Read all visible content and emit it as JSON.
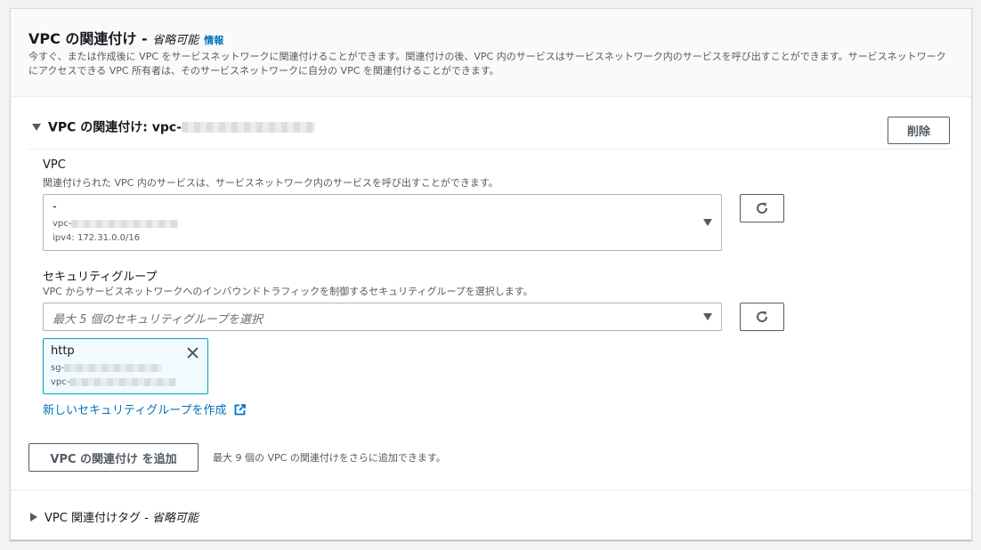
{
  "header": {
    "title": "VPC の関連付け - ",
    "optional": "省略可能",
    "info_link": "情報",
    "description": "今すぐ、または作成後に VPC をサービスネットワークに関連付けることができます。関連付けの後、VPC 内のサービスはサービスネットワーク内のサービスを呼び出すことができます。サービスネットワークにアクセスできる VPC 所有者は、そのサービスネットワークに自分の VPC を関連付けることができます。"
  },
  "association": {
    "title": "VPC の関連付け: vpc-",
    "remove_button": "削除",
    "vpc_field": {
      "label": "VPC",
      "hint": "関連付けられた VPC 内のサービスは、サービスネットワーク内のサービスを呼び出すことができます。",
      "selected_name": "-",
      "selected_id_prefix": "vpc-",
      "selected_cidr": "ipv4: 172.31.0.0/16"
    },
    "security_groups": {
      "label": "セキュリティグループ",
      "hint": "VPC からサービスネットワークへのインバウンドトラフィックを制御するセキュリティグループを選択します。",
      "placeholder": "最大 5 個のセキュリティグループを選択",
      "token": {
        "name": "http",
        "sg_prefix": "sg-",
        "vpc_prefix": "vpc-"
      },
      "create_link": "新しいセキュリティグループを作成"
    }
  },
  "add_button": "VPC の関連付け を追加",
  "add_hint": "最大 9 個の VPC の関連付けをさらに追加できます。",
  "tags_section": {
    "title": "VPC 関連付けタグ - ",
    "optional": "省略可能"
  },
  "icons": {
    "refresh": "refresh-icon",
    "close": "close-icon",
    "external": "external-link-icon",
    "caret_down": "caret-down-icon",
    "caret_right": "caret-right-icon"
  },
  "colors": {
    "link": "#0073bb",
    "token_border": "#00a1c9",
    "token_bg": "#f1faff",
    "header_bg": "#fafafa"
  }
}
